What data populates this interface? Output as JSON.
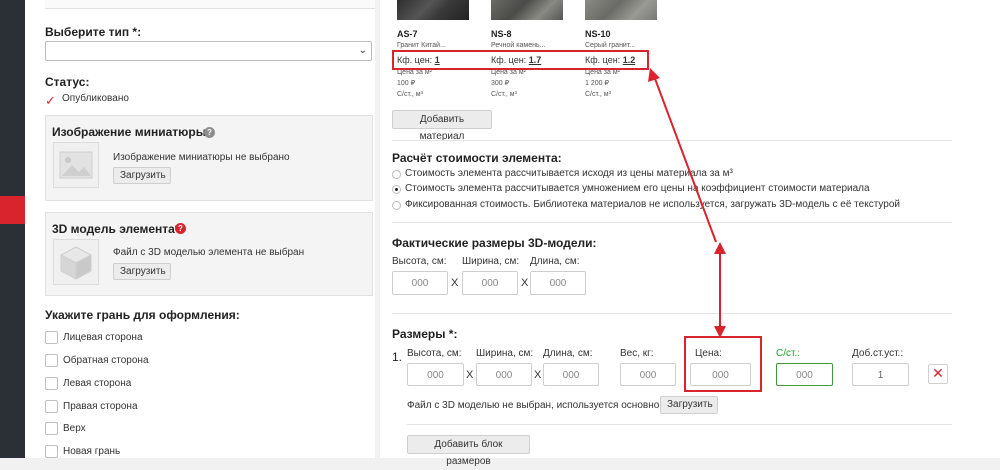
{
  "left": {
    "type_label": "Выберите тип *:",
    "type_value": "",
    "status_label": "Статус:",
    "published_label": "Опубликовано",
    "thumb_title": "Изображение миниатюры:",
    "thumb_empty": "Изображение миниатюры не выбрано",
    "thumb_upload": "Загрузить",
    "model_title": "3D модель элемента*:",
    "model_empty": "Файл с 3D моделью элемента не выбран",
    "model_upload": "Загрузить",
    "faces_title": "Укажите грань для оформления:",
    "faces": [
      "Лицевая сторона",
      "Обратная сторона",
      "Левая сторона",
      "Правая сторона",
      "Верх",
      "Новая грань"
    ]
  },
  "materials": [
    {
      "code": "AS-7",
      "desc": "Гранит Китай...",
      "kf_label": "Кф. цен:",
      "kf_value": "1",
      "price_label": "Цена за м²",
      "price": "100 ₽",
      "unit": "С/ст., м³",
      "color": "#3a3a3a"
    },
    {
      "code": "NS-8",
      "desc": "Речной камень...",
      "kf_label": "Кф. цен:",
      "kf_value": "1.7",
      "price_label": "Цена за м²",
      "price": "300 ₽",
      "unit": "С/ст., м³",
      "color": "#5a5a58"
    },
    {
      "code": "NS-10",
      "desc": "Серый гранит...",
      "kf_label": "Кф. цен:",
      "kf_value": "1.2",
      "price_label": "Цена за м²",
      "price": "1 200 ₽",
      "unit": "С/ст., м³",
      "color": "#7a7a76"
    }
  ],
  "add_material": "Добавить материал",
  "cost": {
    "title": "Расчёт стоимости элемента:",
    "options": [
      {
        "label": "Стоимость элемента рассчитывается исходя из цены материала за м³",
        "selected": false
      },
      {
        "label": "Стоимость элемента рассчитывается умножением его цены на коэффициент стоимости материала",
        "selected": true
      },
      {
        "label": "Фиксированная стоимость. Библиотека материалов не используется, загружать 3D-модель с её текстурой",
        "selected": false
      }
    ]
  },
  "actual": {
    "title": "Фактические размеры 3D-модели:",
    "height_label": "Высота, см:",
    "width_label": "Ширина, см:",
    "length_label": "Длина, см:",
    "placeholder": "000",
    "x": "X"
  },
  "sizes": {
    "title": "Размеры *:",
    "row_number": "1.",
    "height_label": "Высота, см:",
    "width_label": "Ширина, см:",
    "length_label": "Длина, см:",
    "weight_label": "Вес, кг:",
    "price_label": "Цена:",
    "cst_label": "С/ст.:",
    "dob_label": "Доб.ст.уст.:",
    "placeholder": "000",
    "dob_value": "1",
    "x": "X",
    "file_note": "Файл с 3D моделью не выбран, используется основной",
    "upload": "Загрузить",
    "add_block": "Добавить блок размеров"
  },
  "colors": {
    "accent": "#d9232d",
    "green": "#1e9f2e"
  }
}
